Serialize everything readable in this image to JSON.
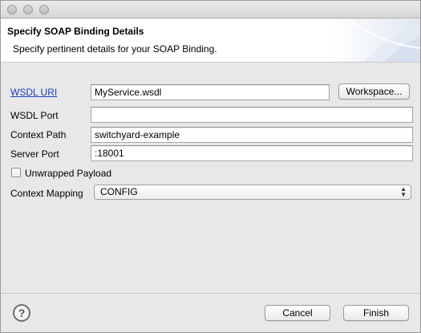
{
  "header": {
    "title": "Specify SOAP Binding Details",
    "description": "Specify pertinent details for your SOAP Binding."
  },
  "form": {
    "wsdl_uri_label": "WSDL URI",
    "wsdl_uri_value": "MyService.wsdl",
    "workspace_button": "Workspace...",
    "wsdl_port_label": "WSDL Port",
    "wsdl_port_value": "",
    "context_path_label": "Context Path",
    "context_path_value": "switchyard-example",
    "server_port_label": "Server Port",
    "server_port_value": ":18001",
    "unwrapped_label": "Unwrapped Payload",
    "unwrapped_checked": false,
    "context_mapping_label": "Context Mapping",
    "context_mapping_value": "CONFIG"
  },
  "footer": {
    "help_glyph": "?",
    "cancel_button": "Cancel",
    "finish_button": "Finish"
  },
  "icons": {
    "help": "help-icon",
    "select_arrows": "up-down-arrows-icon"
  }
}
